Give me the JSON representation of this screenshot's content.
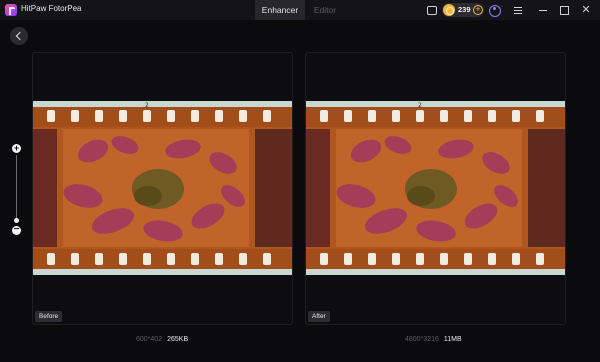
{
  "app": {
    "title": "HitPaw FotorPea"
  },
  "tabs": [
    {
      "label": "Enhancer",
      "active": true
    },
    {
      "label": "Editor",
      "active": false
    }
  ],
  "credits": {
    "count": "239"
  },
  "icons": {
    "logo": "fotorpea-logo-icon",
    "messages": "message-icon",
    "coin": "coin-icon",
    "add_credits": "plus-icon",
    "account": "user-icon",
    "menu": "menu-icon",
    "minimize": "minimize-icon",
    "maximize": "maximize-icon",
    "close": "close-icon",
    "back": "back-arrow-icon",
    "zoom_in": "zoom-in-icon",
    "zoom_out": "zoom-out-icon"
  },
  "zoom": {
    "level": 0.1
  },
  "panels": {
    "before": {
      "tag": "Before",
      "dimensions": "600*402",
      "file_size": "265KB"
    },
    "after": {
      "tag": "After",
      "dimensions": "4800*3216",
      "file_size": "11MB"
    }
  },
  "colors": {
    "film_base": "#b0561f",
    "film_border": "#c8d8d0",
    "leaf": "#a63a5c",
    "moss": "#6e5a22",
    "perforation": "#f2ece0"
  }
}
